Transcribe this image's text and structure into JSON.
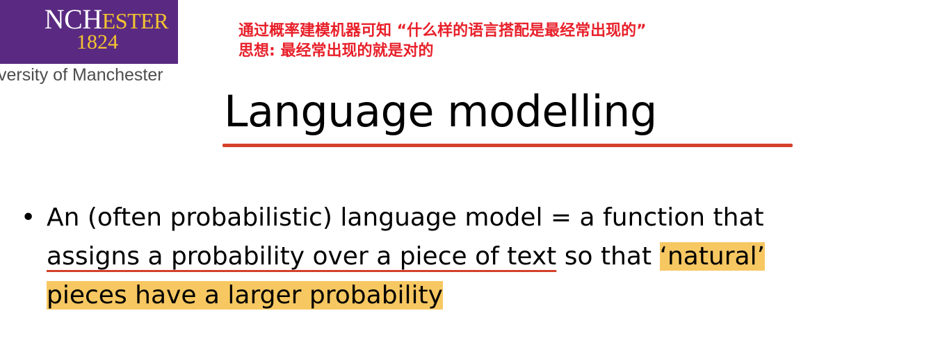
{
  "logo": {
    "name_main": "NCH",
    "name_sc": "ESTER",
    "year": "1824",
    "university": "versity of Manchester"
  },
  "annotation": {
    "line1": "通过概率建模机器可知 “什么样的语言搭配是最经常出现的”",
    "line2": "思想: 最经常出现的就是对的"
  },
  "slide": {
    "title": "Language modelling",
    "bullet": {
      "line1": "An (often probabilistic) language model = a function that",
      "line2_underlined": "assigns a probability over a piece of text",
      "line2_plain": " so that ",
      "line2_highlight": "‘natural’",
      "line3_highlight": "pieces have a larger probability"
    }
  },
  "colors": {
    "logo_purple": "#5a2a82",
    "logo_gold": "#f4c430",
    "annotation_red": "#e8202a",
    "underline_red": "#d4402a",
    "highlight_yellow": "#f7c862"
  }
}
